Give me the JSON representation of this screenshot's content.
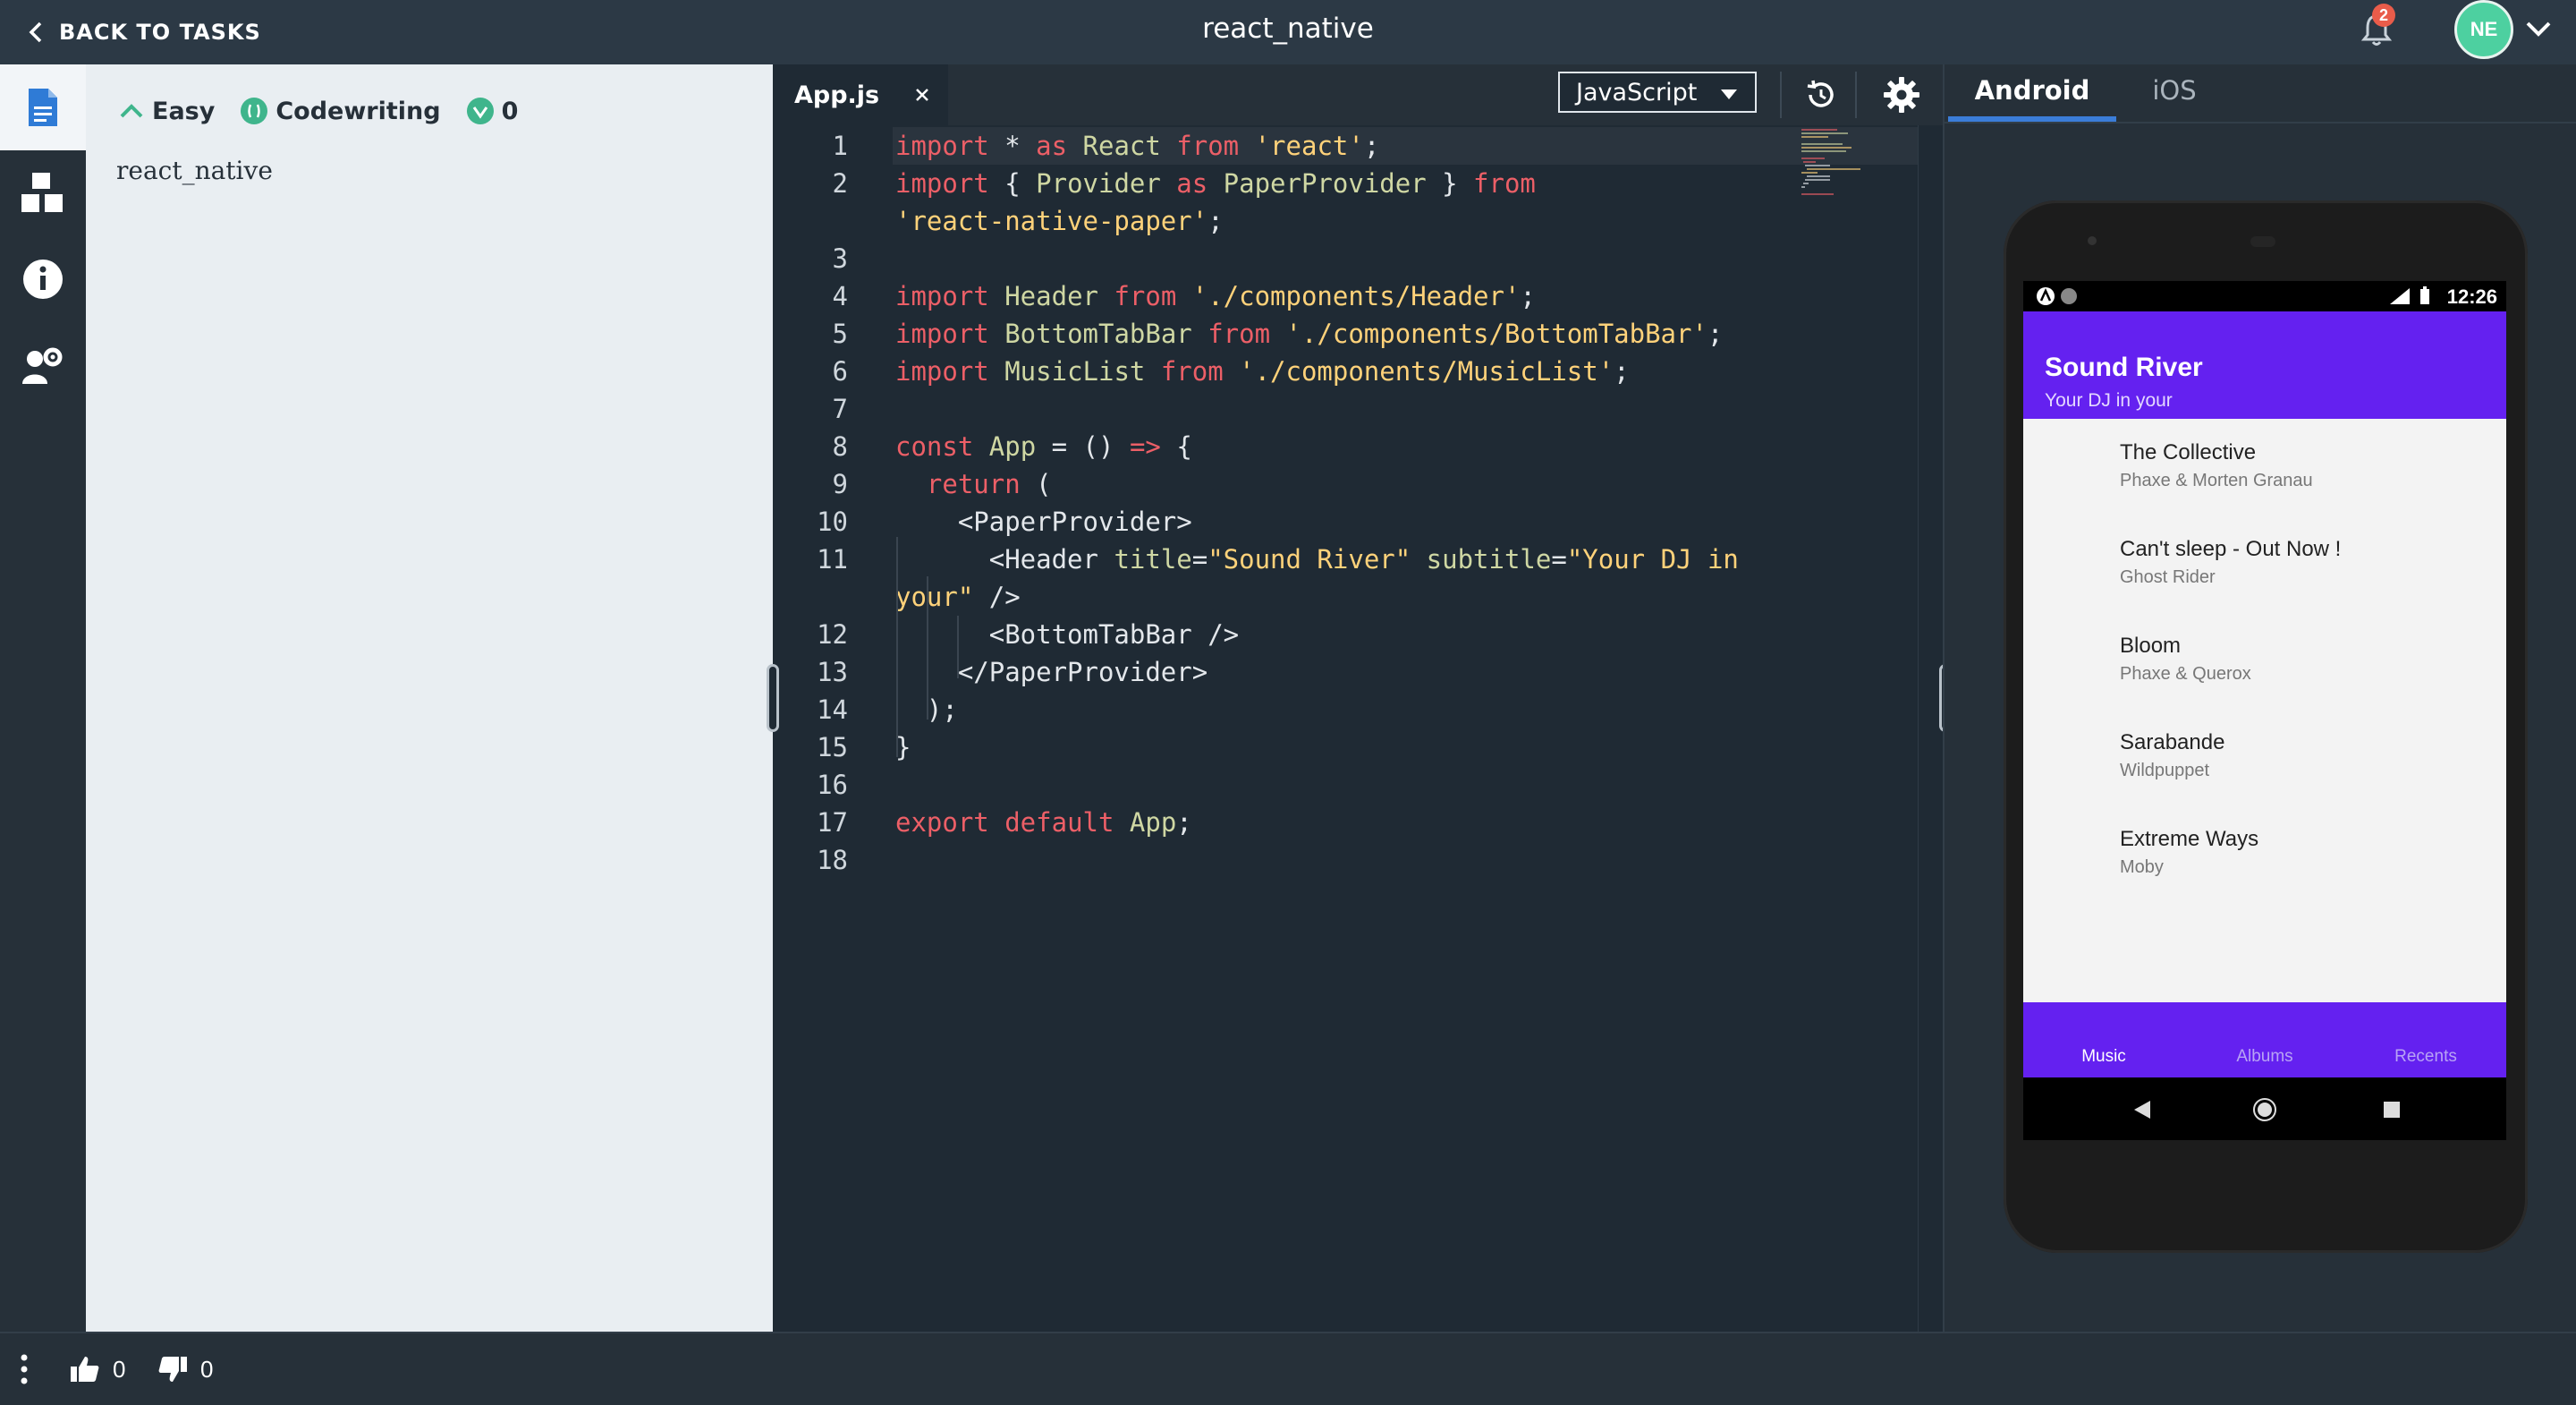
{
  "header": {
    "back_label": "BACK TO TASKS",
    "title": "react_native",
    "notification_count": "2",
    "avatar_initials": "NE"
  },
  "sidebar": {
    "items": [
      {
        "icon": "document-icon",
        "active": true
      },
      {
        "icon": "blocks-icon",
        "active": false
      },
      {
        "icon": "info-icon",
        "active": false
      },
      {
        "icon": "user-settings-icon",
        "active": false
      }
    ]
  },
  "task": {
    "difficulty": "Easy",
    "type": "Codewriting",
    "points": "0",
    "description": "react_native"
  },
  "editor": {
    "file_name": "App.js",
    "language": "JavaScript",
    "lines": [
      {
        "n": "1",
        "tokens": [
          [
            "kw",
            "import"
          ],
          [
            "pl",
            " * "
          ],
          [
            "kw",
            "as"
          ],
          [
            "id",
            " React "
          ],
          [
            "kw",
            "from"
          ],
          [
            "st",
            " 'react'"
          ],
          [
            "pl",
            ";"
          ]
        ]
      },
      {
        "n": "2",
        "tokens": [
          [
            "kw",
            "import"
          ],
          [
            "pl",
            " { "
          ],
          [
            "id",
            "Provider "
          ],
          [
            "kw",
            "as"
          ],
          [
            "id",
            " PaperProvider "
          ],
          [
            "pl",
            "} "
          ],
          [
            "kw",
            "from"
          ]
        ]
      },
      {
        "n": "",
        "tokens": [
          [
            "st",
            "'react-native-paper'"
          ],
          [
            "pl",
            ";"
          ]
        ]
      },
      {
        "n": "3",
        "tokens": []
      },
      {
        "n": "4",
        "tokens": [
          [
            "kw",
            "import"
          ],
          [
            "id",
            " Header "
          ],
          [
            "kw",
            "from"
          ],
          [
            "st",
            " './components/Header'"
          ],
          [
            "pl",
            ";"
          ]
        ]
      },
      {
        "n": "5",
        "tokens": [
          [
            "kw",
            "import"
          ],
          [
            "id",
            " BottomTabBar "
          ],
          [
            "kw",
            "from"
          ],
          [
            "st",
            " './components/BottomTabBar'"
          ],
          [
            "pl",
            ";"
          ]
        ]
      },
      {
        "n": "6",
        "tokens": [
          [
            "kw",
            "import"
          ],
          [
            "id",
            " MusicList "
          ],
          [
            "kw",
            "from"
          ],
          [
            "st",
            " './components/MusicList'"
          ],
          [
            "pl",
            ";"
          ]
        ]
      },
      {
        "n": "7",
        "tokens": []
      },
      {
        "n": "8",
        "tokens": [
          [
            "kw",
            "const"
          ],
          [
            "id",
            " App "
          ],
          [
            "pl",
            "= () "
          ],
          [
            "kw",
            "=>"
          ],
          [
            "pl",
            " {"
          ]
        ]
      },
      {
        "n": "9",
        "tokens": [
          [
            "kw",
            "  return"
          ],
          [
            "pl",
            " ("
          ]
        ]
      },
      {
        "n": "10",
        "tokens": [
          [
            "pl",
            "    <PaperProvider>"
          ]
        ]
      },
      {
        "n": "11",
        "tokens": [
          [
            "pl",
            "      <Header "
          ],
          [
            "id",
            "title"
          ],
          [
            "pl",
            "="
          ],
          [
            "st",
            "\"Sound River\""
          ],
          [
            "id",
            " subtitle"
          ],
          [
            "pl",
            "="
          ],
          [
            "st",
            "\"Your DJ in"
          ]
        ]
      },
      {
        "n": "",
        "tokens": [
          [
            "st",
            "your\""
          ],
          [
            "pl",
            " />"
          ]
        ]
      },
      {
        "n": "12",
        "tokens": [
          [
            "pl",
            "      <BottomTabBar />"
          ]
        ]
      },
      {
        "n": "13",
        "tokens": [
          [
            "pl",
            "    </PaperProvider>"
          ]
        ]
      },
      {
        "n": "14",
        "tokens": [
          [
            "pl",
            "  );"
          ]
        ]
      },
      {
        "n": "15",
        "tokens": [
          [
            "pl",
            "}"
          ]
        ]
      },
      {
        "n": "16",
        "tokens": []
      },
      {
        "n": "17",
        "tokens": [
          [
            "kw",
            "export"
          ],
          [
            "kw",
            " default"
          ],
          [
            "id",
            " App"
          ],
          [
            "pl",
            ";"
          ]
        ]
      },
      {
        "n": "18",
        "tokens": []
      }
    ]
  },
  "preview": {
    "tabs": [
      {
        "label": "Android",
        "active": true
      },
      {
        "label": "iOS",
        "active": false
      }
    ],
    "phone": {
      "time": "12:26",
      "app_title": "Sound River",
      "app_subtitle": "Your DJ in your",
      "tracks": [
        {
          "title": "The Collective",
          "artist": "Phaxe & Morten Granau"
        },
        {
          "title": "Can't sleep - Out Now !",
          "artist": "Ghost Rider"
        },
        {
          "title": "Bloom",
          "artist": "Phaxe & Querox"
        },
        {
          "title": "Sarabande",
          "artist": "Wildpuppet"
        },
        {
          "title": "Extreme Ways",
          "artist": "Moby"
        }
      ],
      "bottom_tabs": [
        {
          "label": "Music",
          "active": true
        },
        {
          "label": "Albums",
          "active": false
        },
        {
          "label": "Recents",
          "active": false
        }
      ]
    }
  },
  "footer": {
    "likes": "0",
    "dislikes": "0"
  },
  "colors": {
    "topbar": "#2c3945",
    "accent_blue": "#3b7dd8",
    "app_purple": "#6421f0",
    "keyword": "#ec5f67",
    "string": "#ffd27a"
  }
}
